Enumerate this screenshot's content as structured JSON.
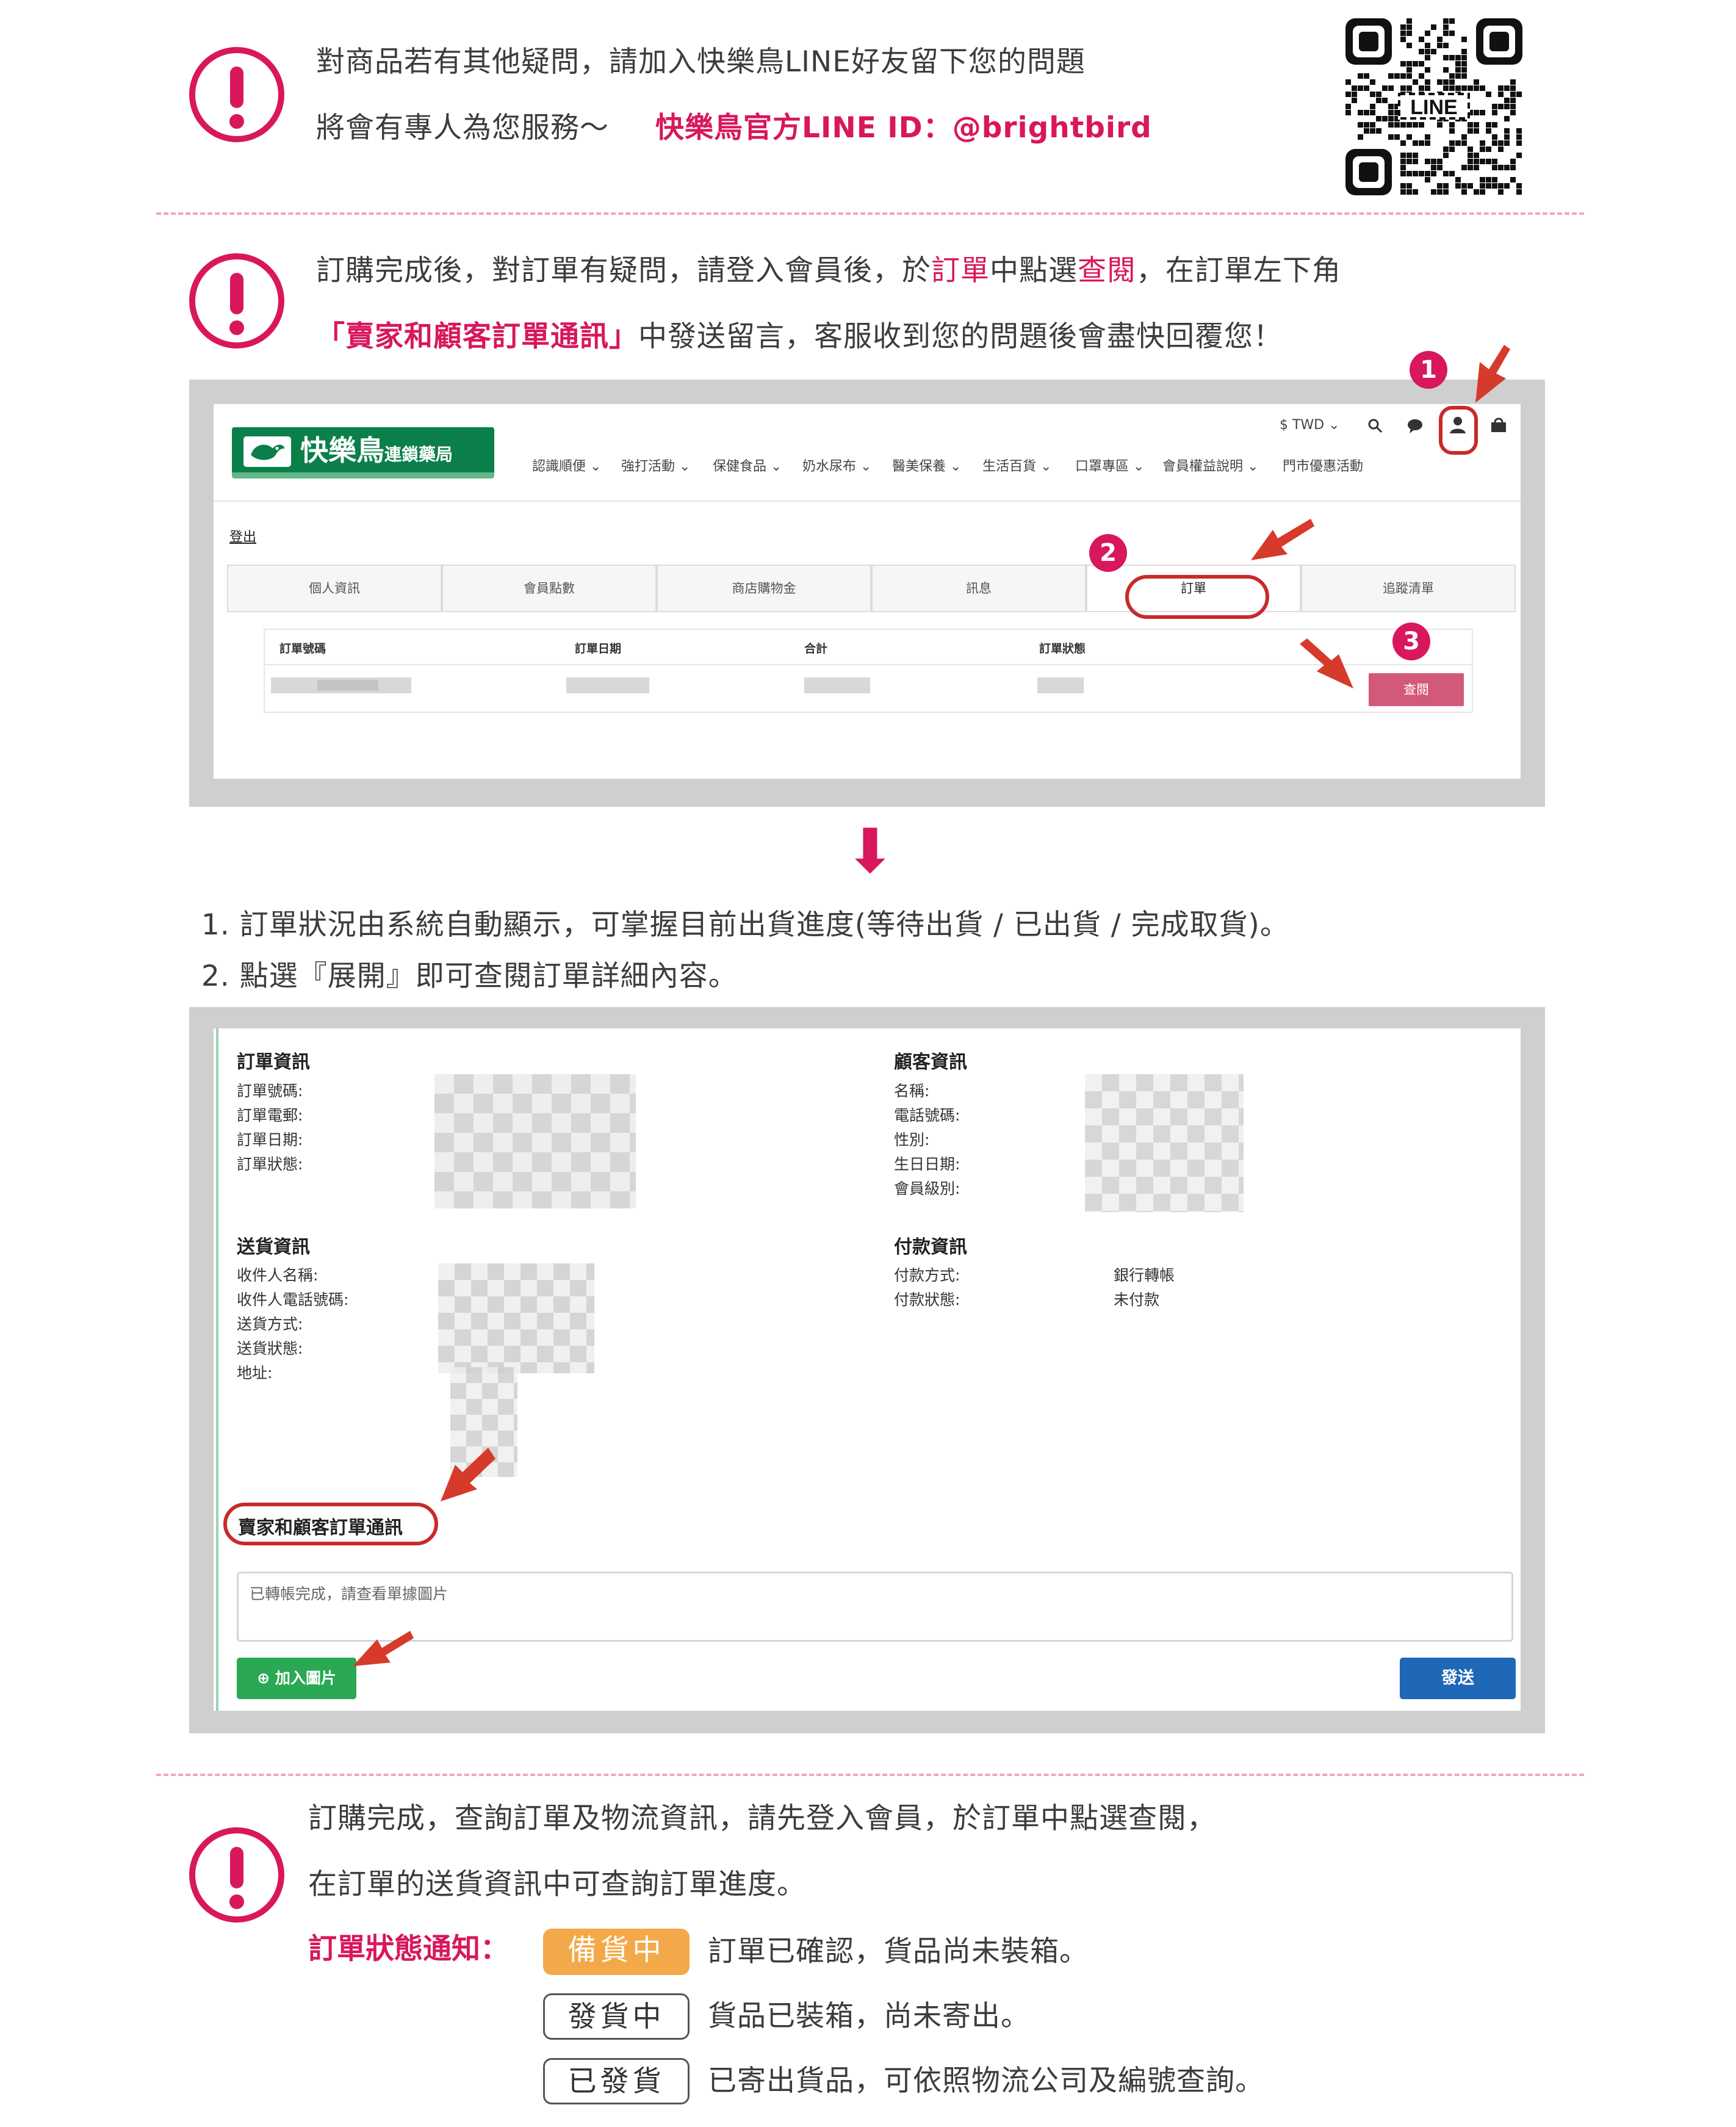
{
  "colors": {
    "accent": "#d8175c",
    "brand_green": "#0b7f4a",
    "view_button": "#d25a78",
    "add_image_button": "#2aa853",
    "send_button": "#1f67b7",
    "status_preparing": "#f3a94a"
  },
  "notice1": {
    "line1": "對商品若有其他疑問，請加入快樂鳥LINE好友留下您的問題",
    "line2_prefix": "將會有專人為您服務～",
    "line2_highlight": "快樂鳥官方LINE ID：@brightbird",
    "qr_label": "LINE"
  },
  "notice2": {
    "l1_a": "訂購完成後，對訂單有疑問，請登入會員後，於",
    "l1_b": "訂單",
    "l1_c": "中點選",
    "l1_d": "查閱",
    "l1_e": "，在訂單左下角",
    "l2_a": "「賣家和顧客訂單通訊」",
    "l2_b": "中發送留言，客服收到您的問題後會盡快回覆您！"
  },
  "shot1": {
    "logo_text": "快樂鳥",
    "logo_sub": "連鎖藥局",
    "currency": "$ TWD ⌄",
    "nav": [
      "認識順便 ⌄",
      "強打活動 ⌄",
      "保健食品 ⌄",
      "奶水尿布 ⌄",
      "醫美保養 ⌄",
      "生活百貨 ⌄",
      "口罩專區 ⌄",
      "會員權益說明 ⌄",
      "門市優惠活動"
    ],
    "logout": "登出",
    "tabs": [
      "個人資訊",
      "會員點數",
      "商店購物金",
      "訊息",
      "訂單",
      "追蹤清單"
    ],
    "table_headers": [
      "訂單號碼",
      "訂單日期",
      "合計",
      "訂單狀態"
    ],
    "view_button": "查閱",
    "steps": [
      "1",
      "2",
      "3"
    ]
  },
  "arrow_down": "⬇",
  "instructions": [
    "1. 訂單狀況由系統自動顯示，可掌握目前出貨進度(等待出貨 / 已出貨 / 完成取貨)。",
    "2. 點選『展開』即可查閱訂單詳細內容。"
  ],
  "shot2": {
    "order_info_title": "訂單資訊",
    "order_info_fields": [
      "訂單號碼:",
      "訂單電郵:",
      "訂單日期:",
      "訂單狀態:"
    ],
    "customer_info_title": "顧客資訊",
    "customer_info_fields": [
      "名稱:",
      "電話號碼:",
      "性別:",
      "生日日期:",
      "會員級別:"
    ],
    "delivery_info_title": "送貨資訊",
    "delivery_info_fields": [
      "收件人名稱:",
      "收件人電話號碼:",
      "送貨方式:",
      "送貨狀態:",
      "地址:"
    ],
    "payment_info_title": "付款資訊",
    "payment_info_fields": [
      "付款方式:",
      "付款狀態:"
    ],
    "payment_info_values": [
      "銀行轉帳",
      "未付款"
    ],
    "chat_title": "賣家和顧客訂單通訊",
    "message_text": "已轉帳完成，請查看單據圖片",
    "add_image_button": "⊕ 加入圖片",
    "send_button": "發送"
  },
  "notice3": {
    "line1": "訂購完成，查詢訂單及物流資訊，請先登入會員，於訂單中點選查閱，",
    "line2": "在訂單的送貨資訊中可查詢訂單進度。",
    "status_label": "訂單狀態通知：",
    "statuses": [
      {
        "chip": "備貨中",
        "desc": "訂單已確認，貨品尚未裝箱。"
      },
      {
        "chip": "發貨中",
        "desc": "貨品已裝箱，尚未寄出。"
      },
      {
        "chip": "已發貨",
        "desc": "已寄出貨品，可依照物流公司及編號查詢。"
      }
    ]
  }
}
